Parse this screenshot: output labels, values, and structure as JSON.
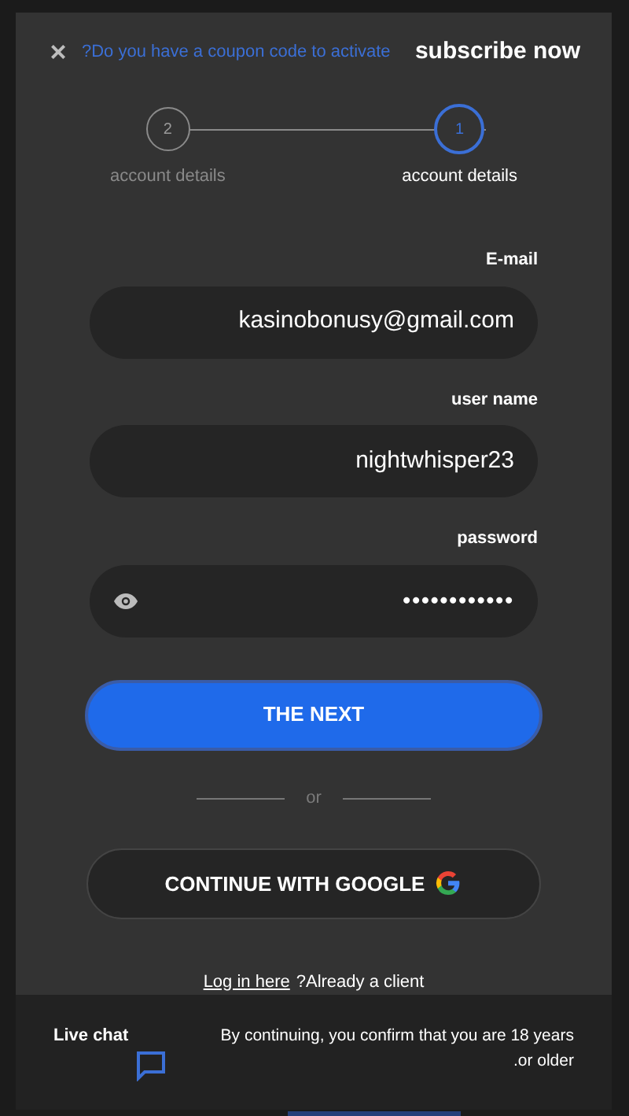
{
  "header": {
    "close_label": "×",
    "coupon_link": "?Do you have a coupon code to activate",
    "title": "subscribe now"
  },
  "steps": [
    {
      "number": "2",
      "label": "account details",
      "selected": false
    },
    {
      "number": "1",
      "label": "account details",
      "selected": true
    }
  ],
  "fields": [
    {
      "label": "E-mail",
      "value": "kasinobonusy@gmail.com",
      "kind": "text"
    },
    {
      "label": "user name",
      "value": "nightwhisper23",
      "kind": "text"
    },
    {
      "label": "password",
      "value": "••••••••••••",
      "kind": "password"
    }
  ],
  "next_button": "THE NEXT",
  "divider": "or",
  "google_button": "CONTINUE WITH GOOGLE",
  "login": {
    "link": "Log in here",
    "text": "?Already a client"
  },
  "footer": {
    "live_chat": "Live chat",
    "notice": "By continuing, you confirm that you are 18 years .or older"
  }
}
